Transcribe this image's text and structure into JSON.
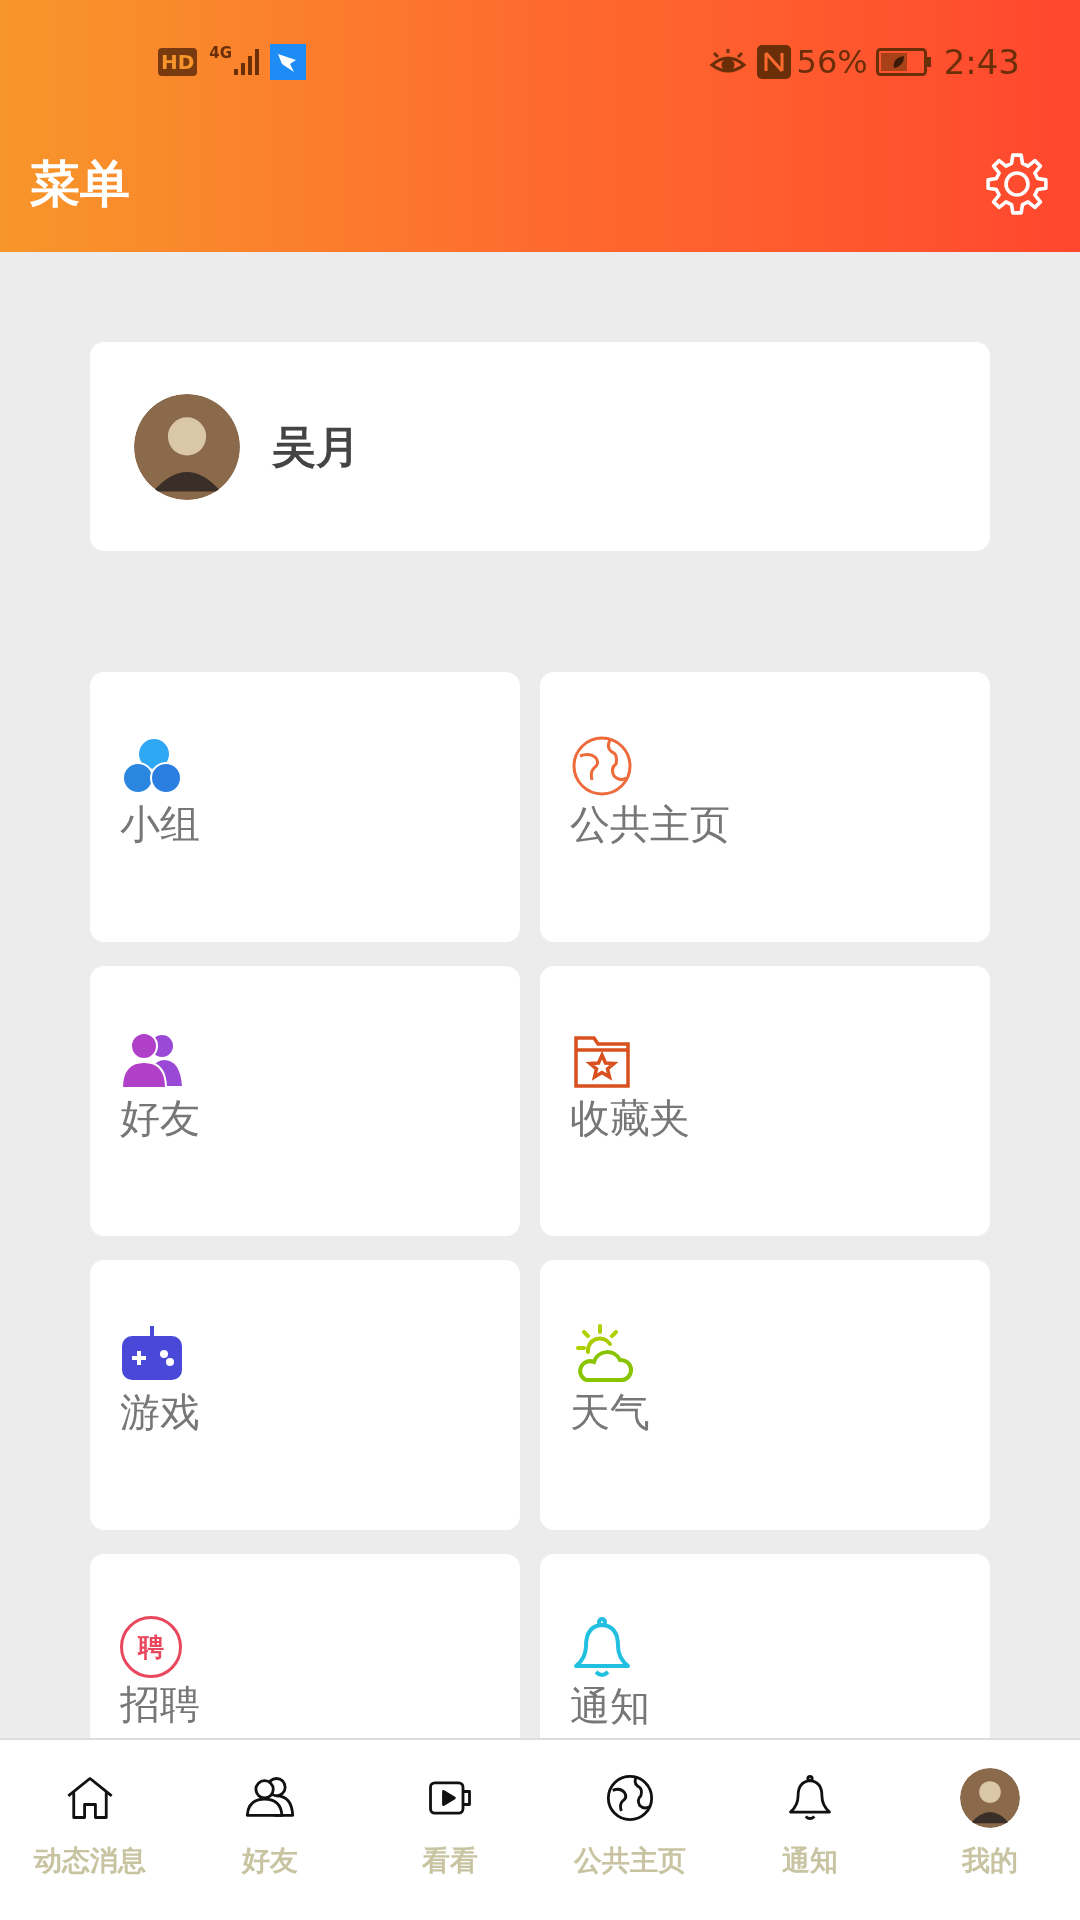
{
  "status_bar": {
    "network_badge": "HD",
    "network_type": "4G",
    "battery": "56%",
    "time": "2:43"
  },
  "header": {
    "title": "菜单"
  },
  "profile": {
    "name": "吴月"
  },
  "menu_items": [
    {
      "kind": "groups",
      "label": "小组"
    },
    {
      "kind": "globe",
      "label": "公共主页"
    },
    {
      "kind": "friends",
      "label": "好友"
    },
    {
      "kind": "favorites",
      "label": "收藏夹"
    },
    {
      "kind": "games",
      "label": "游戏"
    },
    {
      "kind": "weather",
      "label": "天气"
    },
    {
      "kind": "jobs",
      "label": "招聘",
      "icon_text": "聘"
    },
    {
      "kind": "bell",
      "label": "通知"
    }
  ],
  "bottom_nav": [
    {
      "kind": "home",
      "label": "动态消息"
    },
    {
      "kind": "friends",
      "label": "好友"
    },
    {
      "kind": "video",
      "label": "看看"
    },
    {
      "kind": "globe",
      "label": "公共主页"
    },
    {
      "kind": "bell",
      "label": "通知"
    },
    {
      "kind": "avatar",
      "label": "我的"
    }
  ]
}
